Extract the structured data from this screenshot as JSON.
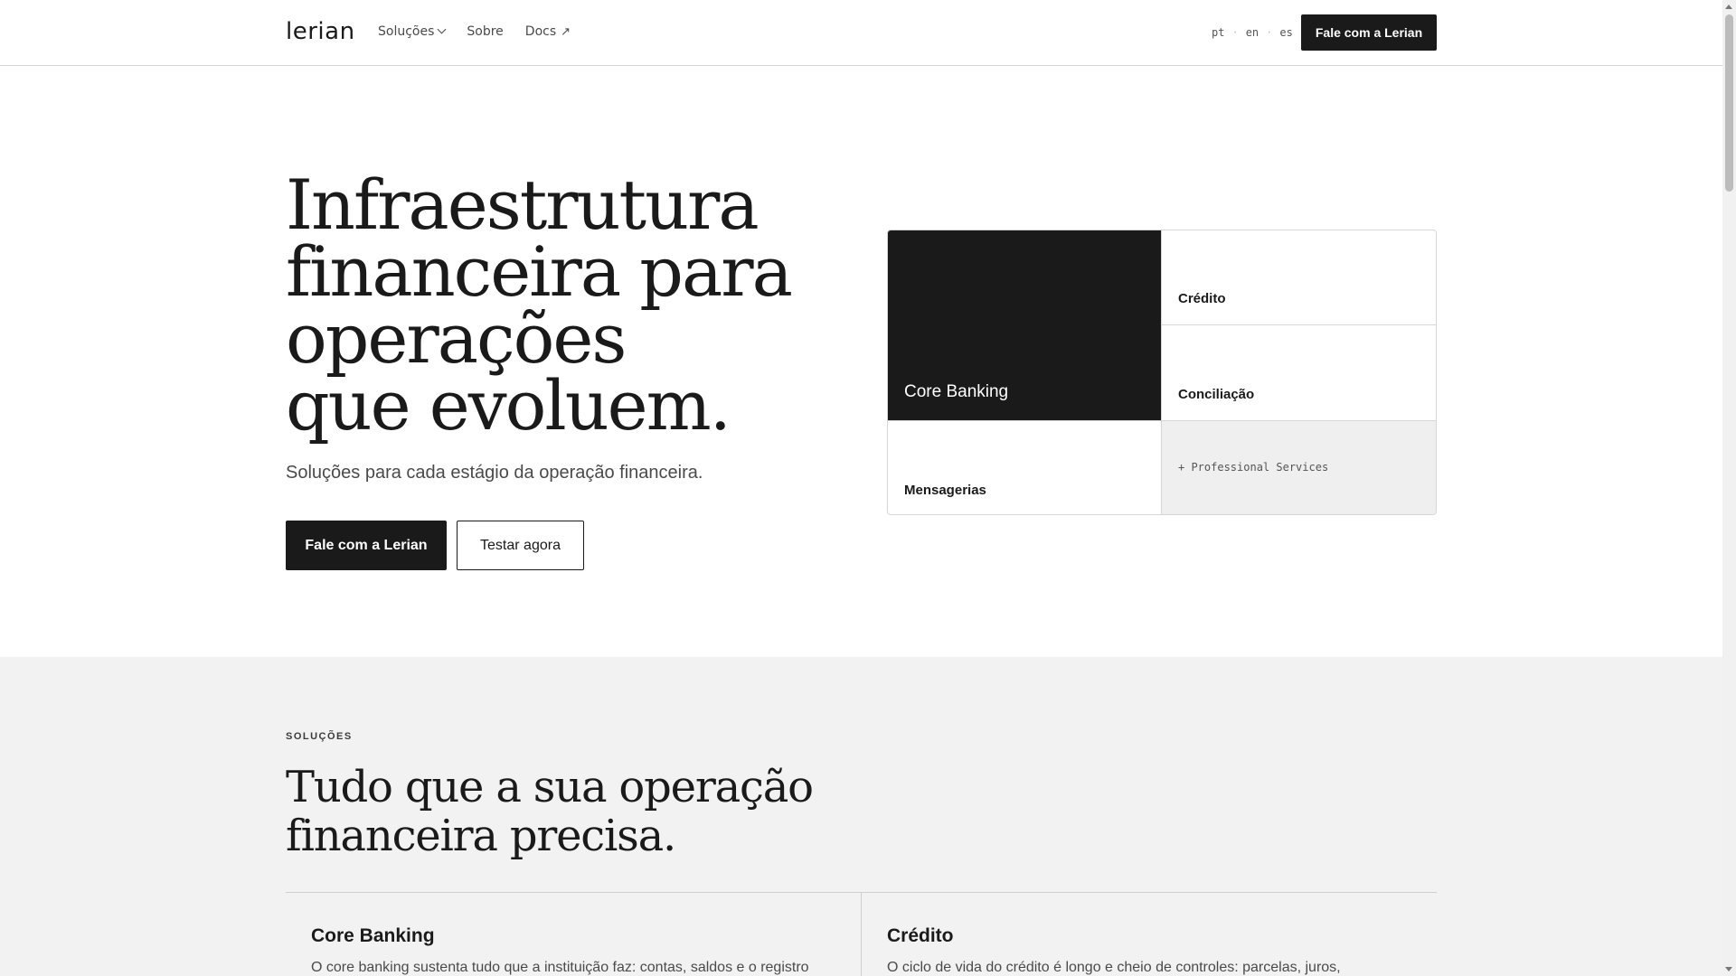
{
  "header": {
    "logo": "lerian",
    "nav": [
      {
        "label": "Soluções",
        "has_dropdown": true
      },
      {
        "label": "Sobre"
      },
      {
        "label": "Docs",
        "suffix": "↗"
      }
    ],
    "languages": [
      "pt",
      "en",
      "es"
    ],
    "cta_label": "Fale com a Lerian"
  },
  "hero": {
    "title_lines": [
      "Infraestrutura",
      "financeira para",
      "operações",
      "que evoluem."
    ],
    "subtitle": "Soluções para cada estágio da operação financeira.",
    "primary_button": "Fale com a Lerian",
    "secondary_button": "Testar agora",
    "grid": {
      "core_banking": "Core Banking",
      "credito": "Crédito",
      "conciliacao": "Conciliação",
      "mensagerias": "Mensagerias",
      "professional_services": "+ Professional Services"
    }
  },
  "solutions": {
    "eyebrow": "SOLUÇÕES",
    "title_lines": [
      "Tudo que a sua operação",
      "financeira precisa."
    ],
    "cards": [
      {
        "title": "Core Banking",
        "text": "O core banking sustenta tudo que a instituição faz: contas, saldos e o registro"
      },
      {
        "title": "Crédito",
        "text": "O ciclo de vida do crédito é longo e cheio de controles: parcelas, juros,"
      }
    ]
  },
  "colors": {
    "ink": "#1a1a1a",
    "muted": "#4a4a4a",
    "section_bg": "#f2f2f2",
    "tile_grey": "#efefef"
  }
}
